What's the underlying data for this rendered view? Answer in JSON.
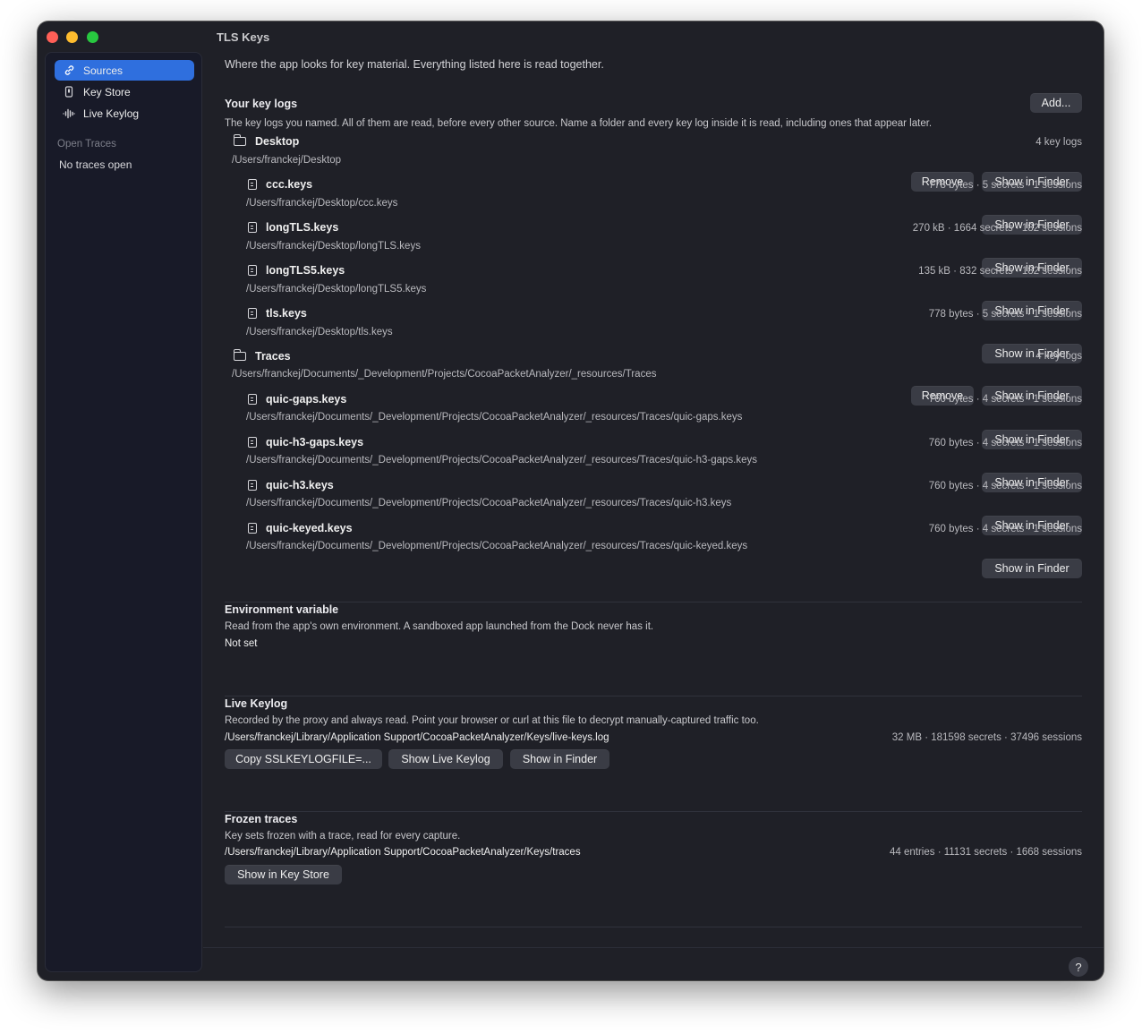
{
  "window": {
    "title": "TLS Keys"
  },
  "sidebar": {
    "items": [
      {
        "label": "Sources",
        "icon": "link-icon"
      },
      {
        "label": "Key Store",
        "icon": "keystore-icon"
      },
      {
        "label": "Live Keylog",
        "icon": "waveform-icon"
      }
    ],
    "section_label": "Open Traces",
    "empty_label": "No traces open"
  },
  "intro": "Where the app looks for key material. Everything listed here is read together.",
  "key_logs": {
    "title": "Your key logs",
    "add_label": "Add...",
    "description": "The key logs you named. All of them are read, before every other source. Name a folder and every key log inside it is read, including ones that appear later.",
    "folders": [
      {
        "name": "Desktop",
        "path": "/Users/franckej/Desktop",
        "count": "4 key logs",
        "remove_label": "Remove",
        "finder_label": "Show in Finder",
        "files": [
          {
            "name": "ccc.keys",
            "path": "/Users/franckej/Desktop/ccc.keys",
            "meta": "778 bytes · 5 secrets · 1 sessions",
            "finder_label": "Show in Finder"
          },
          {
            "name": "longTLS.keys",
            "path": "/Users/franckej/Desktop/longTLS.keys",
            "meta": "270 kB · 1664 secrets · 182 sessions",
            "finder_label": "Show in Finder"
          },
          {
            "name": "longTLS5.keys",
            "path": "/Users/franckej/Desktop/longTLS5.keys",
            "meta": "135 kB · 832 secrets · 182 sessions",
            "finder_label": "Show in Finder"
          },
          {
            "name": "tls.keys",
            "path": "/Users/franckej/Desktop/tls.keys",
            "meta": "778 bytes · 5 secrets · 1 sessions",
            "finder_label": "Show in Finder"
          }
        ]
      },
      {
        "name": "Traces",
        "path": "/Users/franckej/Documents/_Development/Projects/CocoaPacketAnalyzer/_resources/Traces",
        "count": "4 key logs",
        "remove_label": "Remove",
        "finder_label": "Show in Finder",
        "files": [
          {
            "name": "quic-gaps.keys",
            "path": "/Users/franckej/Documents/_Development/Projects/CocoaPacketAnalyzer/_resources/Traces/quic-gaps.keys",
            "meta": "760 bytes · 4 secrets · 1 sessions",
            "finder_label": "Show in Finder"
          },
          {
            "name": "quic-h3-gaps.keys",
            "path": "/Users/franckej/Documents/_Development/Projects/CocoaPacketAnalyzer/_resources/Traces/quic-h3-gaps.keys",
            "meta": "760 bytes · 4 secrets · 1 sessions",
            "finder_label": "Show in Finder"
          },
          {
            "name": "quic-h3.keys",
            "path": "/Users/franckej/Documents/_Development/Projects/CocoaPacketAnalyzer/_resources/Traces/quic-h3.keys",
            "meta": "760 bytes · 4 secrets · 1 sessions",
            "finder_label": "Show in Finder"
          },
          {
            "name": "quic-keyed.keys",
            "path": "/Users/franckej/Documents/_Development/Projects/CocoaPacketAnalyzer/_resources/Traces/quic-keyed.keys",
            "meta": "760 bytes · 4 secrets · 1 sessions",
            "finder_label": "Show in Finder"
          }
        ]
      }
    ]
  },
  "env": {
    "title": "Environment variable",
    "description": "Read from the app's own environment. A sandboxed app launched from the Dock never has it.",
    "value": "Not set"
  },
  "live": {
    "title": "Live Keylog",
    "description": "Recorded by the proxy and always read. Point your browser or curl at this file to decrypt manually-captured traffic too.",
    "path": "/Users/franckej/Library/Application Support/CocoaPacketAnalyzer/Keys/live-keys.log",
    "meta": "32 MB · 181598 secrets · 37496 sessions",
    "copy_label": "Copy SSLKEYLOGFILE=...",
    "show_label": "Show Live Keylog",
    "finder_label": "Show in Finder"
  },
  "frozen": {
    "title": "Frozen traces",
    "description": "Key sets frozen with a trace, read for every capture.",
    "path": "/Users/franckej/Library/Application Support/CocoaPacketAnalyzer/Keys/traces",
    "meta": "44 entries · 11131 secrets · 1668 sessions",
    "keystore_label": "Show in Key Store"
  },
  "help_label": "?"
}
